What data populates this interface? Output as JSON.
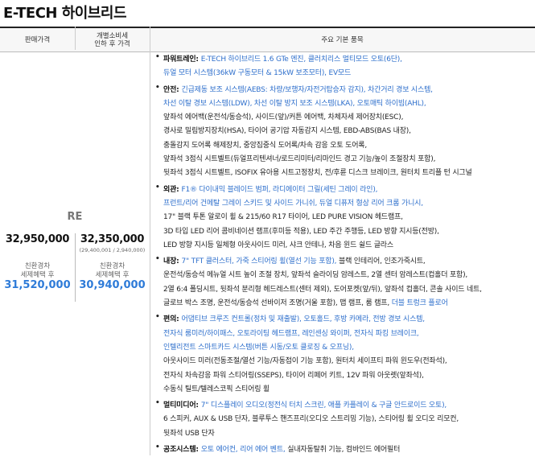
{
  "title": "E-TECH 하이브리드",
  "header": {
    "col1": "판매가격",
    "col2_line1": "개별소비세",
    "col2_line2": "인하 후 가격",
    "col3": "주요 기본 품목"
  },
  "trim": {
    "name": "RE",
    "price": "32,950,000",
    "price_after_tax": "32,350,000",
    "tax_detail": "(29,400,001 / 2,940,000)",
    "eco_label_1": "친환경차",
    "eco_label_2": "세제혜택 후",
    "eco_price": "31,520,000",
    "eco_label_3": "친환경차",
    "eco_label_4": "세제혜택 후",
    "eco_price_after_tax": "30,940,000"
  },
  "sections": [
    {
      "label": "파워트레인",
      "lines": [
        {
          "hl": "E-TECH 하이브리드 1.6 GTe 엔진, 클러치리스 멀티모드 오토(6단),",
          "dk": ""
        },
        {
          "hl": "듀얼 모터 시스템(36kW 구동모터 & 15kW 보조모터), EV모드",
          "dk": ""
        }
      ]
    },
    {
      "label": "안전",
      "lines": [
        {
          "hl": "긴급제동 보조 시스템(AEBS: 차량/보행자/자전거탑승자 감지), 차간거리 경보 시스템,",
          "dk": ""
        },
        {
          "hl": "차선 이탈 경보 시스템(LDW), 차선 이탈 방지 보조 시스템(LKA), 오토매틱 하이빔(AHL),",
          "dk": ""
        },
        {
          "hl": "",
          "dk": "앞좌석 에어백(운전석/동승석), 사이드(앞)/커튼 에어백, 차체자세 제어장치(ESC),"
        },
        {
          "hl": "",
          "dk": "경사로 밀림방지장치(HSA), 타이어 공기압 자동감지 시스템, EBD-ABS(BAS 내장),"
        },
        {
          "hl": "",
          "dk": "충돌감지 도어록 해제장치, 중앙집중식 도어록/차속 감응 오토 도어록,"
        },
        {
          "hl": "",
          "dk": "앞좌석 3점식 시트벨트(듀얼프리텐셔너/로드리미터/리마인드 경고 기능/높이 조절장치 포함),"
        },
        {
          "hl": "",
          "dk": "뒷좌석 3점식 시트벨트, ISOFIX 유아용 시트고정장치, 전/후륜 디스크 브레이크, 원터치 트리플 턴 시그널"
        }
      ]
    },
    {
      "label": "외관",
      "lines": [
        {
          "hl": "F1® 다이내믹 블레이드 범퍼, 라디에이터 그릴(세틴 그레이 라인),",
          "dk": ""
        },
        {
          "hl": "프런트/리어 건메탈 그레이 스키드 및 사이드 가니쉬, 듀얼 디퓨저 형상 리어 크롬 가니시,",
          "dk": ""
        },
        {
          "hl": "",
          "dk": "17\" 블랙 투톤 알로이 휠 & 215/60 R17 타이어, LED PURE VISION 헤드램프,"
        },
        {
          "hl": "",
          "dk": "3D 타입 LED 리어 콤비네이션 램프(후미등 적용), LED 주간 주행등, LED 방향 지시등(전방),"
        },
        {
          "hl": "",
          "dk": "LED 방향 지시등 일체형 아웃사이드 미러, 샤크 안테나, 차음 윈드 쉴드 글라스"
        }
      ]
    },
    {
      "label": "내장",
      "lines": [
        {
          "hl": "7\" TFT 클러스터, 가죽 스티어링 휠(열선 기능 포함),",
          "dk": " 블랙 인테리어, 인조가죽시트,"
        },
        {
          "hl": "",
          "dk": "운전석/동승석 메뉴얼 시트 높이 조절 장치, 앞좌석 슬라이딩 암레스트, 2열 센터 암레스트(컵홀더 포함),"
        },
        {
          "hl": "",
          "dk": "2열 6:4 폴딩시트, 뒷좌석 분리형 헤드레스트(센터 제외), 도어포켓(앞/뒤), 앞좌석 컵홀더, 콘솔 사이드 네트,"
        },
        {
          "hl": "",
          "dk": "글로브 박스 조명, 운전석/동승석 선바이저 조명(거울 포함), 맵 램프, 룸 램프,",
          "hl2": " 더블 트렁크 플로어"
        }
      ]
    },
    {
      "label": "편의",
      "lines": [
        {
          "hl": "어댑티브 크루즈 컨트롤(정차 및 재출발), 오토홀드, 후방 카메라, 전방 경보 시스템,",
          "dk": ""
        },
        {
          "hl": "전자식 룸미러/하이패스, 오토라이팅 헤드램프, 레인센싱 와이퍼, 전자식 파킹 브레이크,",
          "dk": ""
        },
        {
          "hl": "인텔리전트 스마트카드 시스템(버튼 시동/오토 클로징 & 오프닝),",
          "dk": ""
        },
        {
          "hl": "",
          "dk": "아웃사이드 미러(전동조절/열선 기능/자동접이 기능 포함), 원터치 세이프티 파워 윈도우(전좌석),"
        },
        {
          "hl": "",
          "dk": "전자식 차속감응 파워 스티어링(SSEPS), 타이어 리페어 키트, 12V 파워 아웃렛(앞좌석),"
        },
        {
          "hl": "",
          "dk": "수동식 틸트/텔레스코픽 스티어링 휠"
        }
      ]
    },
    {
      "label": "멀티미디어",
      "lines": [
        {
          "hl": "7\" 디스플레이 오디오(정전식 터치 스크린, 애플 카플레이 & 구글 안드로이드 오토),",
          "dk": ""
        },
        {
          "hl": "",
          "dk": "6 스피커, AUX & USB 단자, 블루투스 핸즈프리(오디오 스트리밍 기능), 스티어링 휠 오디오 리모컨,"
        },
        {
          "hl": "",
          "dk": "뒷좌석 USB 단자"
        }
      ]
    },
    {
      "label": "공조시스템",
      "lines": [
        {
          "hl": "오토 에어컨, 리어 에어 벤트,",
          "dk": " 실내자동탈취 기능, 컴바인드 에어필터"
        }
      ]
    }
  ]
}
